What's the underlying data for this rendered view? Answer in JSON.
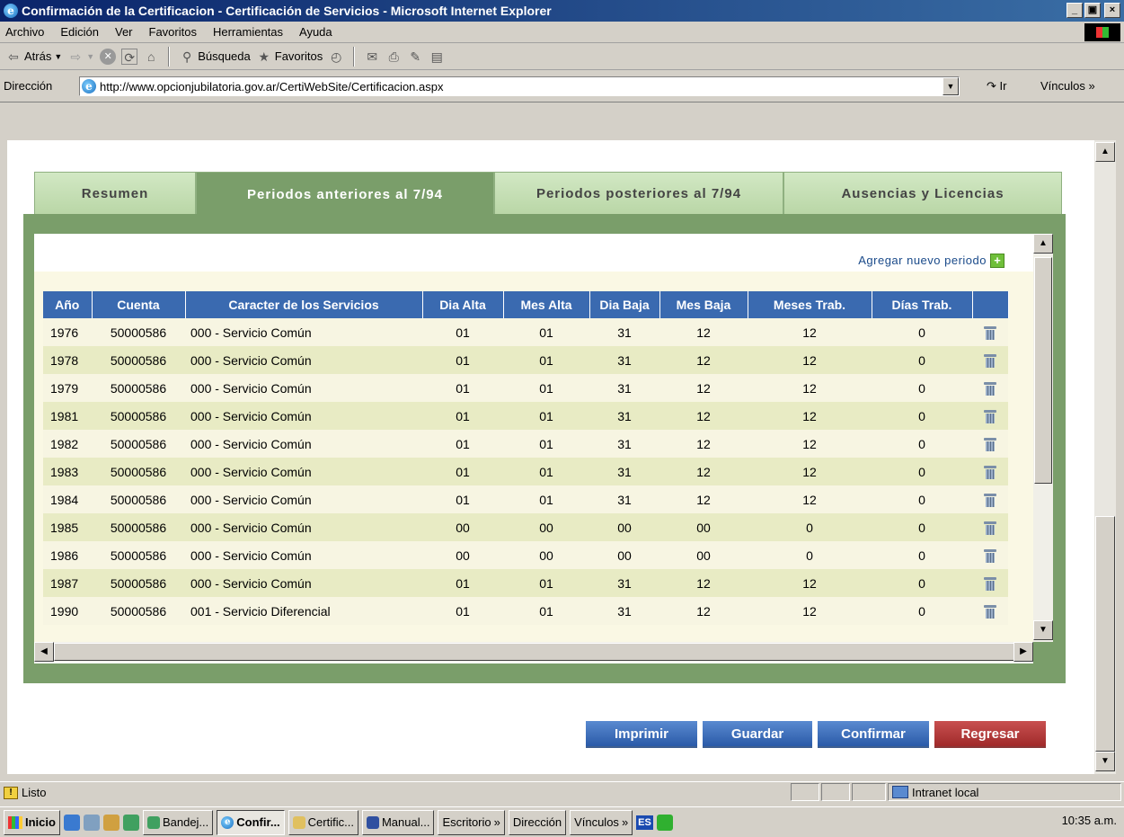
{
  "window": {
    "title": "Confirmación de la Certificacion - Certificación de Servicios - Microsoft Internet Explorer"
  },
  "menu": [
    "Archivo",
    "Edición",
    "Ver",
    "Favoritos",
    "Herramientas",
    "Ayuda"
  ],
  "toolbar": {
    "back": "Atrás",
    "search": "Búsqueda",
    "favorites": "Favoritos"
  },
  "address": {
    "label": "Dirección",
    "url": "http://www.opcionjubilatoria.gov.ar/CertiWebSite/Certificacion.aspx",
    "go": "Ir",
    "links": "Vínculos"
  },
  "tabs": [
    {
      "label": "Resumen",
      "active": false
    },
    {
      "label": "Periodos anteriores al 7/94",
      "active": true
    },
    {
      "label": "Periodos posteriores al 7/94",
      "active": false
    },
    {
      "label": "Ausencias y Licencias",
      "active": false
    }
  ],
  "add_period": "Agregar nuevo periodo",
  "table": {
    "headers": [
      "Año",
      "Cuenta",
      "Caracter de los Servicios",
      "Dia Alta",
      "Mes Alta",
      "Dia Baja",
      "Mes Baja",
      "Meses Trab.",
      "Días Trab.",
      ""
    ],
    "rows": [
      [
        "1976",
        "50000586",
        "000 - Servicio Común",
        "01",
        "01",
        "31",
        "12",
        "12",
        "0"
      ],
      [
        "1978",
        "50000586",
        "000 - Servicio Común",
        "01",
        "01",
        "31",
        "12",
        "12",
        "0"
      ],
      [
        "1979",
        "50000586",
        "000 - Servicio Común",
        "01",
        "01",
        "31",
        "12",
        "12",
        "0"
      ],
      [
        "1981",
        "50000586",
        "000 - Servicio Común",
        "01",
        "01",
        "31",
        "12",
        "12",
        "0"
      ],
      [
        "1982",
        "50000586",
        "000 - Servicio Común",
        "01",
        "01",
        "31",
        "12",
        "12",
        "0"
      ],
      [
        "1983",
        "50000586",
        "000 - Servicio Común",
        "01",
        "01",
        "31",
        "12",
        "12",
        "0"
      ],
      [
        "1984",
        "50000586",
        "000 - Servicio Común",
        "01",
        "01",
        "31",
        "12",
        "12",
        "0"
      ],
      [
        "1985",
        "50000586",
        "000 - Servicio Común",
        "00",
        "00",
        "00",
        "00",
        "0",
        "0"
      ],
      [
        "1986",
        "50000586",
        "000 - Servicio Común",
        "00",
        "00",
        "00",
        "00",
        "0",
        "0"
      ],
      [
        "1987",
        "50000586",
        "000 - Servicio Común",
        "01",
        "01",
        "31",
        "12",
        "12",
        "0"
      ],
      [
        "1990",
        "50000586",
        "001 - Servicio Diferencial",
        "01",
        "01",
        "31",
        "12",
        "12",
        "0"
      ]
    ]
  },
  "buttons": {
    "print": "Imprimir",
    "save": "Guardar",
    "confirm": "Confirmar",
    "back": "Regresar"
  },
  "status": {
    "text": "Listo",
    "zone": "Intranet local"
  },
  "taskbar": {
    "start": "Inicio",
    "tasks": [
      "Bandej...",
      "Confir...",
      "Certific...",
      "Manual..."
    ],
    "desktop": "Escritorio",
    "direccion": "Dirección",
    "links": "Vínculos",
    "lang": "ES",
    "clock": "10:35 a.m."
  },
  "colors": {
    "title_bar": "#0a246a",
    "tab_active": "#7a9e6a",
    "header_blue": "#3a6ab0",
    "btn_blue": "#2a5aa8",
    "btn_red": "#a02a2a"
  }
}
